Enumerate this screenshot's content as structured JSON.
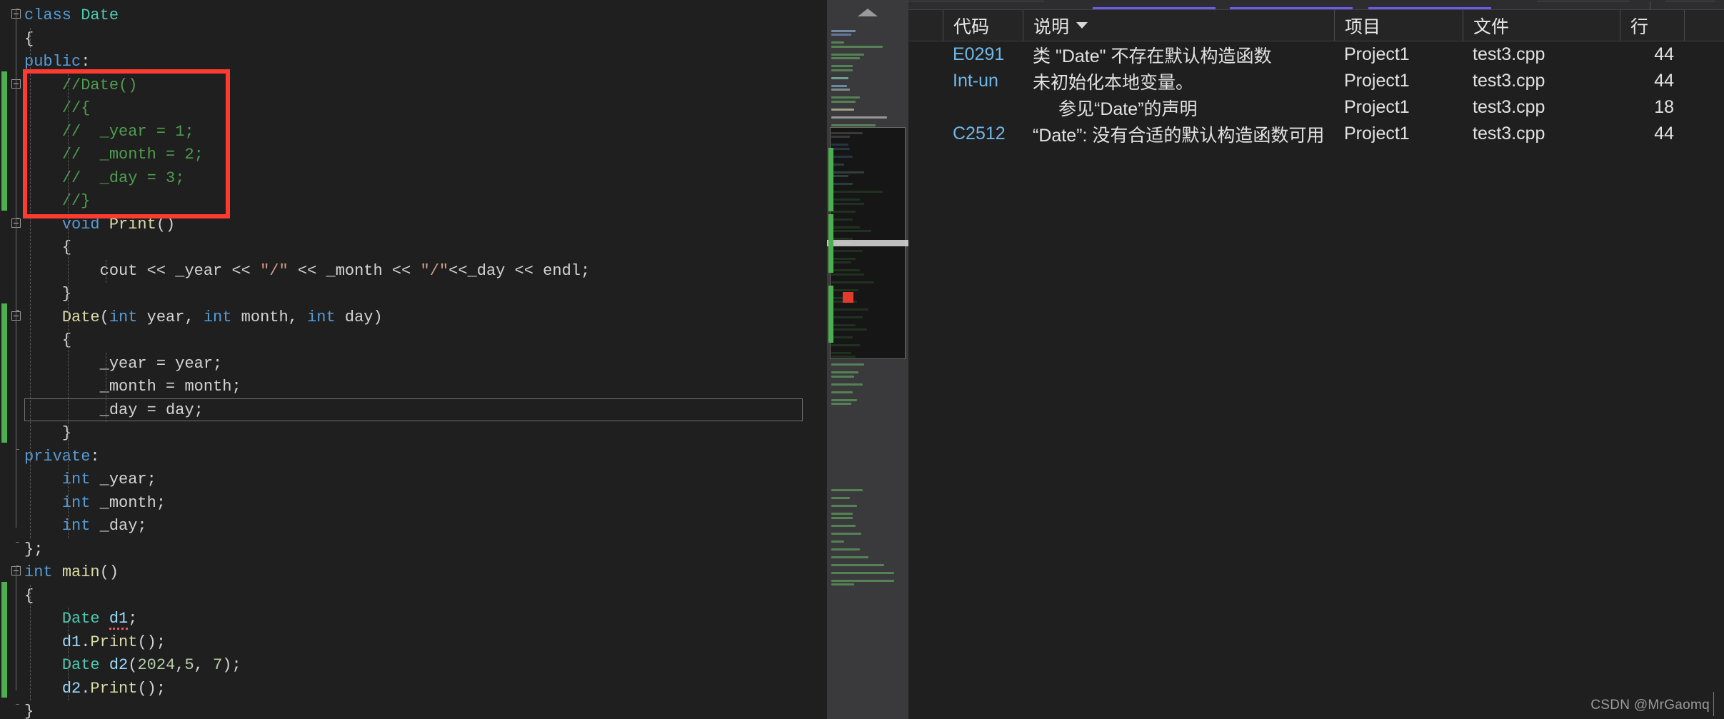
{
  "editor": {
    "language": "cpp",
    "lines": [
      {
        "indent": 0,
        "tokens": [
          {
            "t": "class",
            "c": "k"
          },
          {
            "t": " ",
            "c": "pl"
          },
          {
            "t": "Date",
            "c": "ty"
          }
        ]
      },
      {
        "indent": 0,
        "tokens": [
          {
            "t": "{",
            "c": "pl"
          }
        ]
      },
      {
        "indent": 0,
        "tokens": [
          {
            "t": "public",
            "c": "k"
          },
          {
            "t": ":",
            "c": "pl"
          }
        ]
      },
      {
        "indent": 1,
        "tokens": [
          {
            "t": "//Date()",
            "c": "cm"
          }
        ]
      },
      {
        "indent": 1,
        "tokens": [
          {
            "t": "//{",
            "c": "cm"
          }
        ]
      },
      {
        "indent": 1,
        "tokens": [
          {
            "t": "//  _year = 1;",
            "c": "cm"
          }
        ]
      },
      {
        "indent": 1,
        "tokens": [
          {
            "t": "//  _month = 2;",
            "c": "cm"
          }
        ]
      },
      {
        "indent": 1,
        "tokens": [
          {
            "t": "//  _day = 3;",
            "c": "cm"
          }
        ]
      },
      {
        "indent": 1,
        "tokens": [
          {
            "t": "//}",
            "c": "cm"
          }
        ]
      },
      {
        "indent": 1,
        "tokens": [
          {
            "t": "void",
            "c": "k"
          },
          {
            "t": " ",
            "c": "pl"
          },
          {
            "t": "Print",
            "c": "fn"
          },
          {
            "t": "()",
            "c": "pl"
          }
        ]
      },
      {
        "indent": 1,
        "tokens": [
          {
            "t": "{",
            "c": "pl"
          }
        ]
      },
      {
        "indent": 2,
        "tokens": [
          {
            "t": "cout",
            "c": "pl"
          },
          {
            "t": " << ",
            "c": "op"
          },
          {
            "t": "_year",
            "c": "pl"
          },
          {
            "t": " << ",
            "c": "op"
          },
          {
            "t": "\"/\"",
            "c": "st"
          },
          {
            "t": " << ",
            "c": "op"
          },
          {
            "t": "_month",
            "c": "pl"
          },
          {
            "t": " << ",
            "c": "op"
          },
          {
            "t": "\"/\"",
            "c": "st"
          },
          {
            "t": "<<",
            "c": "op"
          },
          {
            "t": "_day",
            "c": "pl"
          },
          {
            "t": " << ",
            "c": "op"
          },
          {
            "t": "endl",
            "c": "pl"
          },
          {
            "t": ";",
            "c": "pl"
          }
        ]
      },
      {
        "indent": 1,
        "tokens": [
          {
            "t": "}",
            "c": "pl"
          }
        ]
      },
      {
        "indent": 1,
        "tokens": [
          {
            "t": "Date",
            "c": "fn"
          },
          {
            "t": "(",
            "c": "pl"
          },
          {
            "t": "int",
            "c": "k"
          },
          {
            "t": " year, ",
            "c": "pl"
          },
          {
            "t": "int",
            "c": "k"
          },
          {
            "t": " month, ",
            "c": "pl"
          },
          {
            "t": "int",
            "c": "k"
          },
          {
            "t": " day)",
            "c": "pl"
          }
        ]
      },
      {
        "indent": 1,
        "tokens": [
          {
            "t": "{",
            "c": "pl"
          }
        ]
      },
      {
        "indent": 2,
        "tokens": [
          {
            "t": "_year = year;",
            "c": "pl"
          }
        ]
      },
      {
        "indent": 2,
        "tokens": [
          {
            "t": "_month = month;",
            "c": "pl"
          }
        ]
      },
      {
        "indent": 2,
        "tokens": [
          {
            "t": "_day = day;",
            "c": "pl"
          }
        ]
      },
      {
        "indent": 1,
        "tokens": [
          {
            "t": "}",
            "c": "pl"
          }
        ]
      },
      {
        "indent": 0,
        "tokens": [
          {
            "t": "private",
            "c": "k"
          },
          {
            "t": ":",
            "c": "pl"
          }
        ]
      },
      {
        "indent": 1,
        "tokens": [
          {
            "t": "int",
            "c": "k"
          },
          {
            "t": " _year;",
            "c": "pl"
          }
        ]
      },
      {
        "indent": 1,
        "tokens": [
          {
            "t": "int",
            "c": "k"
          },
          {
            "t": " _month;",
            "c": "pl"
          }
        ]
      },
      {
        "indent": 1,
        "tokens": [
          {
            "t": "int",
            "c": "k"
          },
          {
            "t": " _day;",
            "c": "pl"
          }
        ]
      },
      {
        "indent": 0,
        "tokens": [
          {
            "t": "};",
            "c": "pl"
          }
        ]
      },
      {
        "indent": 0,
        "tokens": [
          {
            "t": "int",
            "c": "k"
          },
          {
            "t": " ",
            "c": "pl"
          },
          {
            "t": "main",
            "c": "fn"
          },
          {
            "t": "()",
            "c": "pl"
          }
        ]
      },
      {
        "indent": 0,
        "tokens": [
          {
            "t": "{",
            "c": "pl"
          }
        ]
      },
      {
        "indent": 1,
        "tokens": [
          {
            "t": "Date",
            "c": "ty"
          },
          {
            "t": " ",
            "c": "pl"
          },
          {
            "t": "d1",
            "c": "id",
            "squiggle": true
          },
          {
            "t": ";",
            "c": "pl"
          }
        ]
      },
      {
        "indent": 1,
        "tokens": [
          {
            "t": "d1",
            "c": "id"
          },
          {
            "t": ".",
            "c": "pl"
          },
          {
            "t": "Print",
            "c": "fn"
          },
          {
            "t": "();",
            "c": "pl"
          }
        ]
      },
      {
        "indent": 1,
        "tokens": [
          {
            "t": "Date",
            "c": "ty"
          },
          {
            "t": " ",
            "c": "pl"
          },
          {
            "t": "d2",
            "c": "id"
          },
          {
            "t": "(",
            "c": "pl"
          },
          {
            "t": "2024",
            "c": "num"
          },
          {
            "t": ",",
            "c": "pl"
          },
          {
            "t": "5",
            "c": "num"
          },
          {
            "t": ", ",
            "c": "pl"
          },
          {
            "t": "7",
            "c": "num"
          },
          {
            "t": ");",
            "c": "pl"
          }
        ]
      },
      {
        "indent": 1,
        "tokens": [
          {
            "t": "d2",
            "c": "id"
          },
          {
            "t": ".",
            "c": "pl"
          },
          {
            "t": "Print",
            "c": "fn"
          },
          {
            "t": "();",
            "c": "pl"
          }
        ]
      },
      {
        "indent": 0,
        "tokens": [
          {
            "t": "}",
            "c": "pl"
          }
        ]
      }
    ],
    "annotation": {
      "highlight_box_color": "#ff3b30",
      "highlight_box_lines": [
        3,
        8
      ]
    },
    "current_line_index": 17,
    "change_bar_color": "#4caf50"
  },
  "minimap": {
    "scroll_arrow": "scroll-up-arrow",
    "viewport_border_color": "#6a6a6a",
    "error_marker_color": "#e23b2e",
    "change_marker_color": "#4caf50"
  },
  "error_list": {
    "columns": [
      {
        "key": "icon",
        "label": ""
      },
      {
        "key": "code",
        "label": "代码"
      },
      {
        "key": "desc",
        "label": "说明",
        "sort": "descending"
      },
      {
        "key": "proj",
        "label": "项目"
      },
      {
        "key": "file",
        "label": "文件"
      },
      {
        "key": "line",
        "label": "行"
      },
      {
        "key": "sup",
        "label": ""
      }
    ],
    "rows": [
      {
        "code": "E0291",
        "desc": "类 \"Date\" 不存在默认构造函数",
        "proj": "Project1",
        "file": "test3.cpp",
        "line": "44"
      },
      {
        "code": "Int-un",
        "desc": "未初始化本地变量。",
        "proj": "Project1",
        "file": "test3.cpp",
        "line": "44"
      },
      {
        "code": "",
        "desc": "参见“Date”的声明",
        "proj": "Project1",
        "file": "test3.cpp",
        "line": "18",
        "indented": true
      },
      {
        "code": "C2512",
        "desc": "“Date”: 没有合适的默认构造函数可用",
        "proj": "Project1",
        "file": "test3.cpp",
        "line": "44"
      }
    ],
    "code_color": "#6fb8e8"
  },
  "watermark": {
    "text": "CSDN @MrGaomq"
  }
}
